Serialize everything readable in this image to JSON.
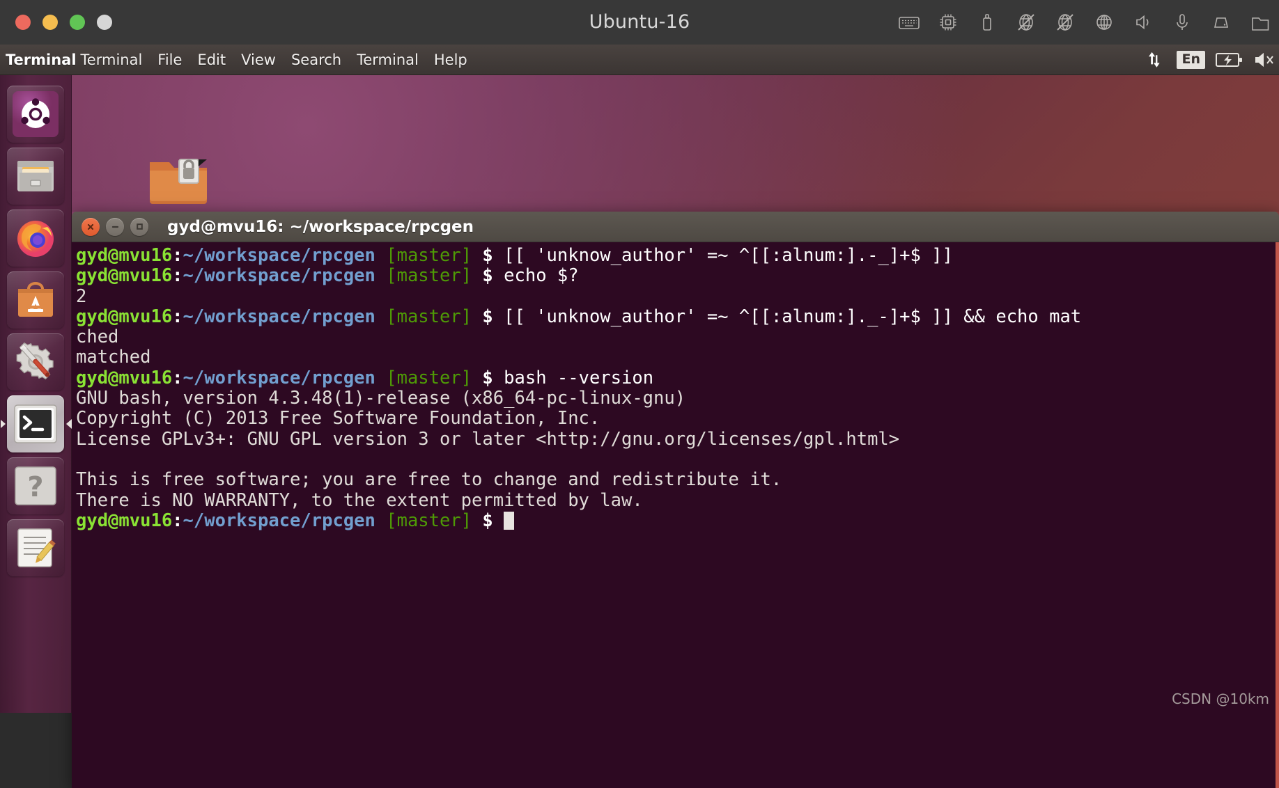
{
  "vm": {
    "title": "Ubuntu-16",
    "window_buttons": [
      {
        "name": "close",
        "color": "#ed6a5e"
      },
      {
        "name": "minimize",
        "color": "#f5bd4f"
      },
      {
        "name": "maximize",
        "color": "#61c555"
      },
      {
        "name": "extra",
        "color": "#d6d6d6"
      }
    ],
    "tray_icons": [
      "keyboard-icon",
      "cpu-icon",
      "usb-drive-icon",
      "network-disabled-icon",
      "network-disabled-2-icon",
      "globe-icon",
      "speaker-icon",
      "microphone-icon",
      "harddisk-icon",
      "shared-folder-icon"
    ]
  },
  "panel": {
    "app_name": "Terminal",
    "menus": [
      {
        "label": "Terminal"
      },
      {
        "label": "File"
      },
      {
        "label": "Edit"
      },
      {
        "label": "View"
      },
      {
        "label": "Search"
      },
      {
        "label": "Terminal"
      },
      {
        "label": "Help"
      }
    ],
    "indicators": {
      "network_label": "network-updown-icon",
      "keyboard_layout": "En",
      "battery_label": "battery-charging-icon",
      "volume_label": "volume-muted-icon"
    }
  },
  "launcher": {
    "items": [
      {
        "name": "dash-home",
        "label": "Ubuntu Dash Home",
        "icon": "ubuntu-logo-icon",
        "active": false
      },
      {
        "name": "files",
        "label": "Files",
        "icon": "file-cabinet-icon",
        "active": false
      },
      {
        "name": "firefox",
        "label": "Firefox Web Browser",
        "icon": "firefox-icon",
        "active": false
      },
      {
        "name": "software-center",
        "label": "Ubuntu Software",
        "icon": "software-bag-icon",
        "active": false
      },
      {
        "name": "system-settings",
        "label": "System Settings",
        "icon": "gear-wrench-icon",
        "active": false
      },
      {
        "name": "terminal",
        "label": "Terminal",
        "icon": "terminal-icon",
        "active": true
      },
      {
        "name": "help",
        "label": "Ubuntu Help",
        "icon": "question-mark-icon",
        "active": false
      },
      {
        "name": "text-editor",
        "label": "Text Editor",
        "icon": "notepad-pencil-icon",
        "active": false
      }
    ]
  },
  "desktop": {
    "folder_icon_label": "locked-folder-icon"
  },
  "terminal": {
    "title": "gyd@mvu16: ~/workspace/rpcgen",
    "buttons": {
      "close": "close-icon",
      "minimize": "minimize-icon",
      "maximize": "maximize-icon"
    },
    "prompt": {
      "user_host": "gyd@mvu16",
      "colon": ":",
      "path": "~/workspace/rpcgen",
      "branch": "[master]",
      "dollar": "$"
    },
    "lines": [
      {
        "type": "prompt",
        "command": "[[ 'unknow_author' =~ ^[[:alnum:].-_]+$ ]]"
      },
      {
        "type": "prompt",
        "command": "echo $?"
      },
      {
        "type": "output",
        "text": "2"
      },
      {
        "type": "prompt",
        "command": "[[ 'unknow_author' =~ ^[[:alnum:]._-]+$ ]] && echo mat"
      },
      {
        "type": "output",
        "text": "ched"
      },
      {
        "type": "output",
        "text": "matched"
      },
      {
        "type": "prompt",
        "command": "bash --version"
      },
      {
        "type": "output",
        "text": "GNU bash, version 4.3.48(1)-release (x86_64-pc-linux-gnu)"
      },
      {
        "type": "output",
        "text": "Copyright (C) 2013 Free Software Foundation, Inc."
      },
      {
        "type": "output",
        "text": "License GPLv3+: GNU GPL version 3 or later <http://gnu.org/licenses/gpl.html>"
      },
      {
        "type": "output",
        "text": ""
      },
      {
        "type": "output",
        "text": "This is free software; you are free to change and redistribute it."
      },
      {
        "type": "output",
        "text": "There is NO WARRANTY, to the extent permitted by law."
      },
      {
        "type": "prompt-cursor",
        "command": ""
      }
    ],
    "colors": {
      "background": "#2d0922",
      "user_host": "#8ae234",
      "path": "#729fcf",
      "branch": "#4e9a06",
      "text": "#e8e4e0"
    }
  },
  "watermark": "CSDN @10km"
}
